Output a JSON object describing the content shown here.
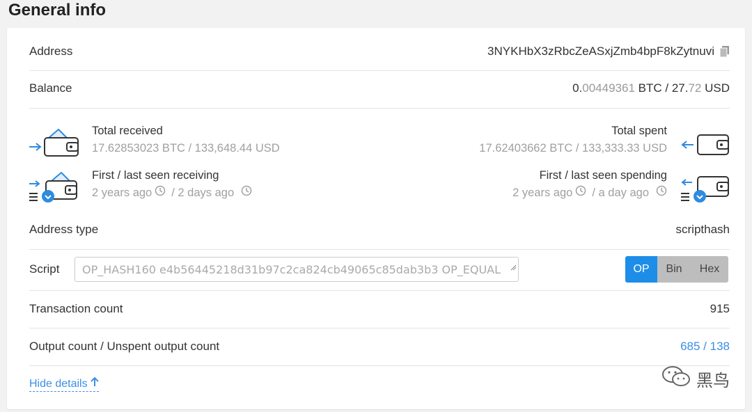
{
  "page_title": "General info",
  "address": {
    "label": "Address",
    "value": "3NYKHbX3zRbcZeASxjZmb4bpF8kZytnuvi"
  },
  "balance": {
    "label": "Balance",
    "btc_int": "0.",
    "btc_dec": "00449361",
    "btc_unit": " BTC / ",
    "usd_int": "27.",
    "usd_dec": "72",
    "usd_unit": " USD"
  },
  "total_received": {
    "label": "Total received",
    "value": "17.62853023 BTC / 133,648.44 USD"
  },
  "total_spent": {
    "label": "Total spent",
    "value": "17.62403662 BTC / 133,333.33 USD"
  },
  "receiving_seen": {
    "label": "First / last seen receiving",
    "first": "2 years ago",
    "last": "/ 2 days ago"
  },
  "spending_seen": {
    "label": "First / last seen spending",
    "first": "2 years ago",
    "last": "/ a day ago"
  },
  "address_type": {
    "label": "Address type",
    "value": "scripthash"
  },
  "script": {
    "label": "Script",
    "value": "OP_HASH160 e4b56445218d31b97c2ca824cb49065c85dab3b3 OP_EQUAL",
    "modes": [
      "OP",
      "Bin",
      "Hex"
    ],
    "active_mode": "OP"
  },
  "transaction_count": {
    "label": "Transaction count",
    "value": "915"
  },
  "output_count": {
    "label": "Output count / Unspent output count",
    "outputs": "685",
    "separator": " / ",
    "unspent": "138"
  },
  "hide_details": "Hide details",
  "watermark": "黑鸟",
  "colors": {
    "accent": "#1e8de8",
    "link": "#3a8ee6",
    "muted": "#999999"
  }
}
